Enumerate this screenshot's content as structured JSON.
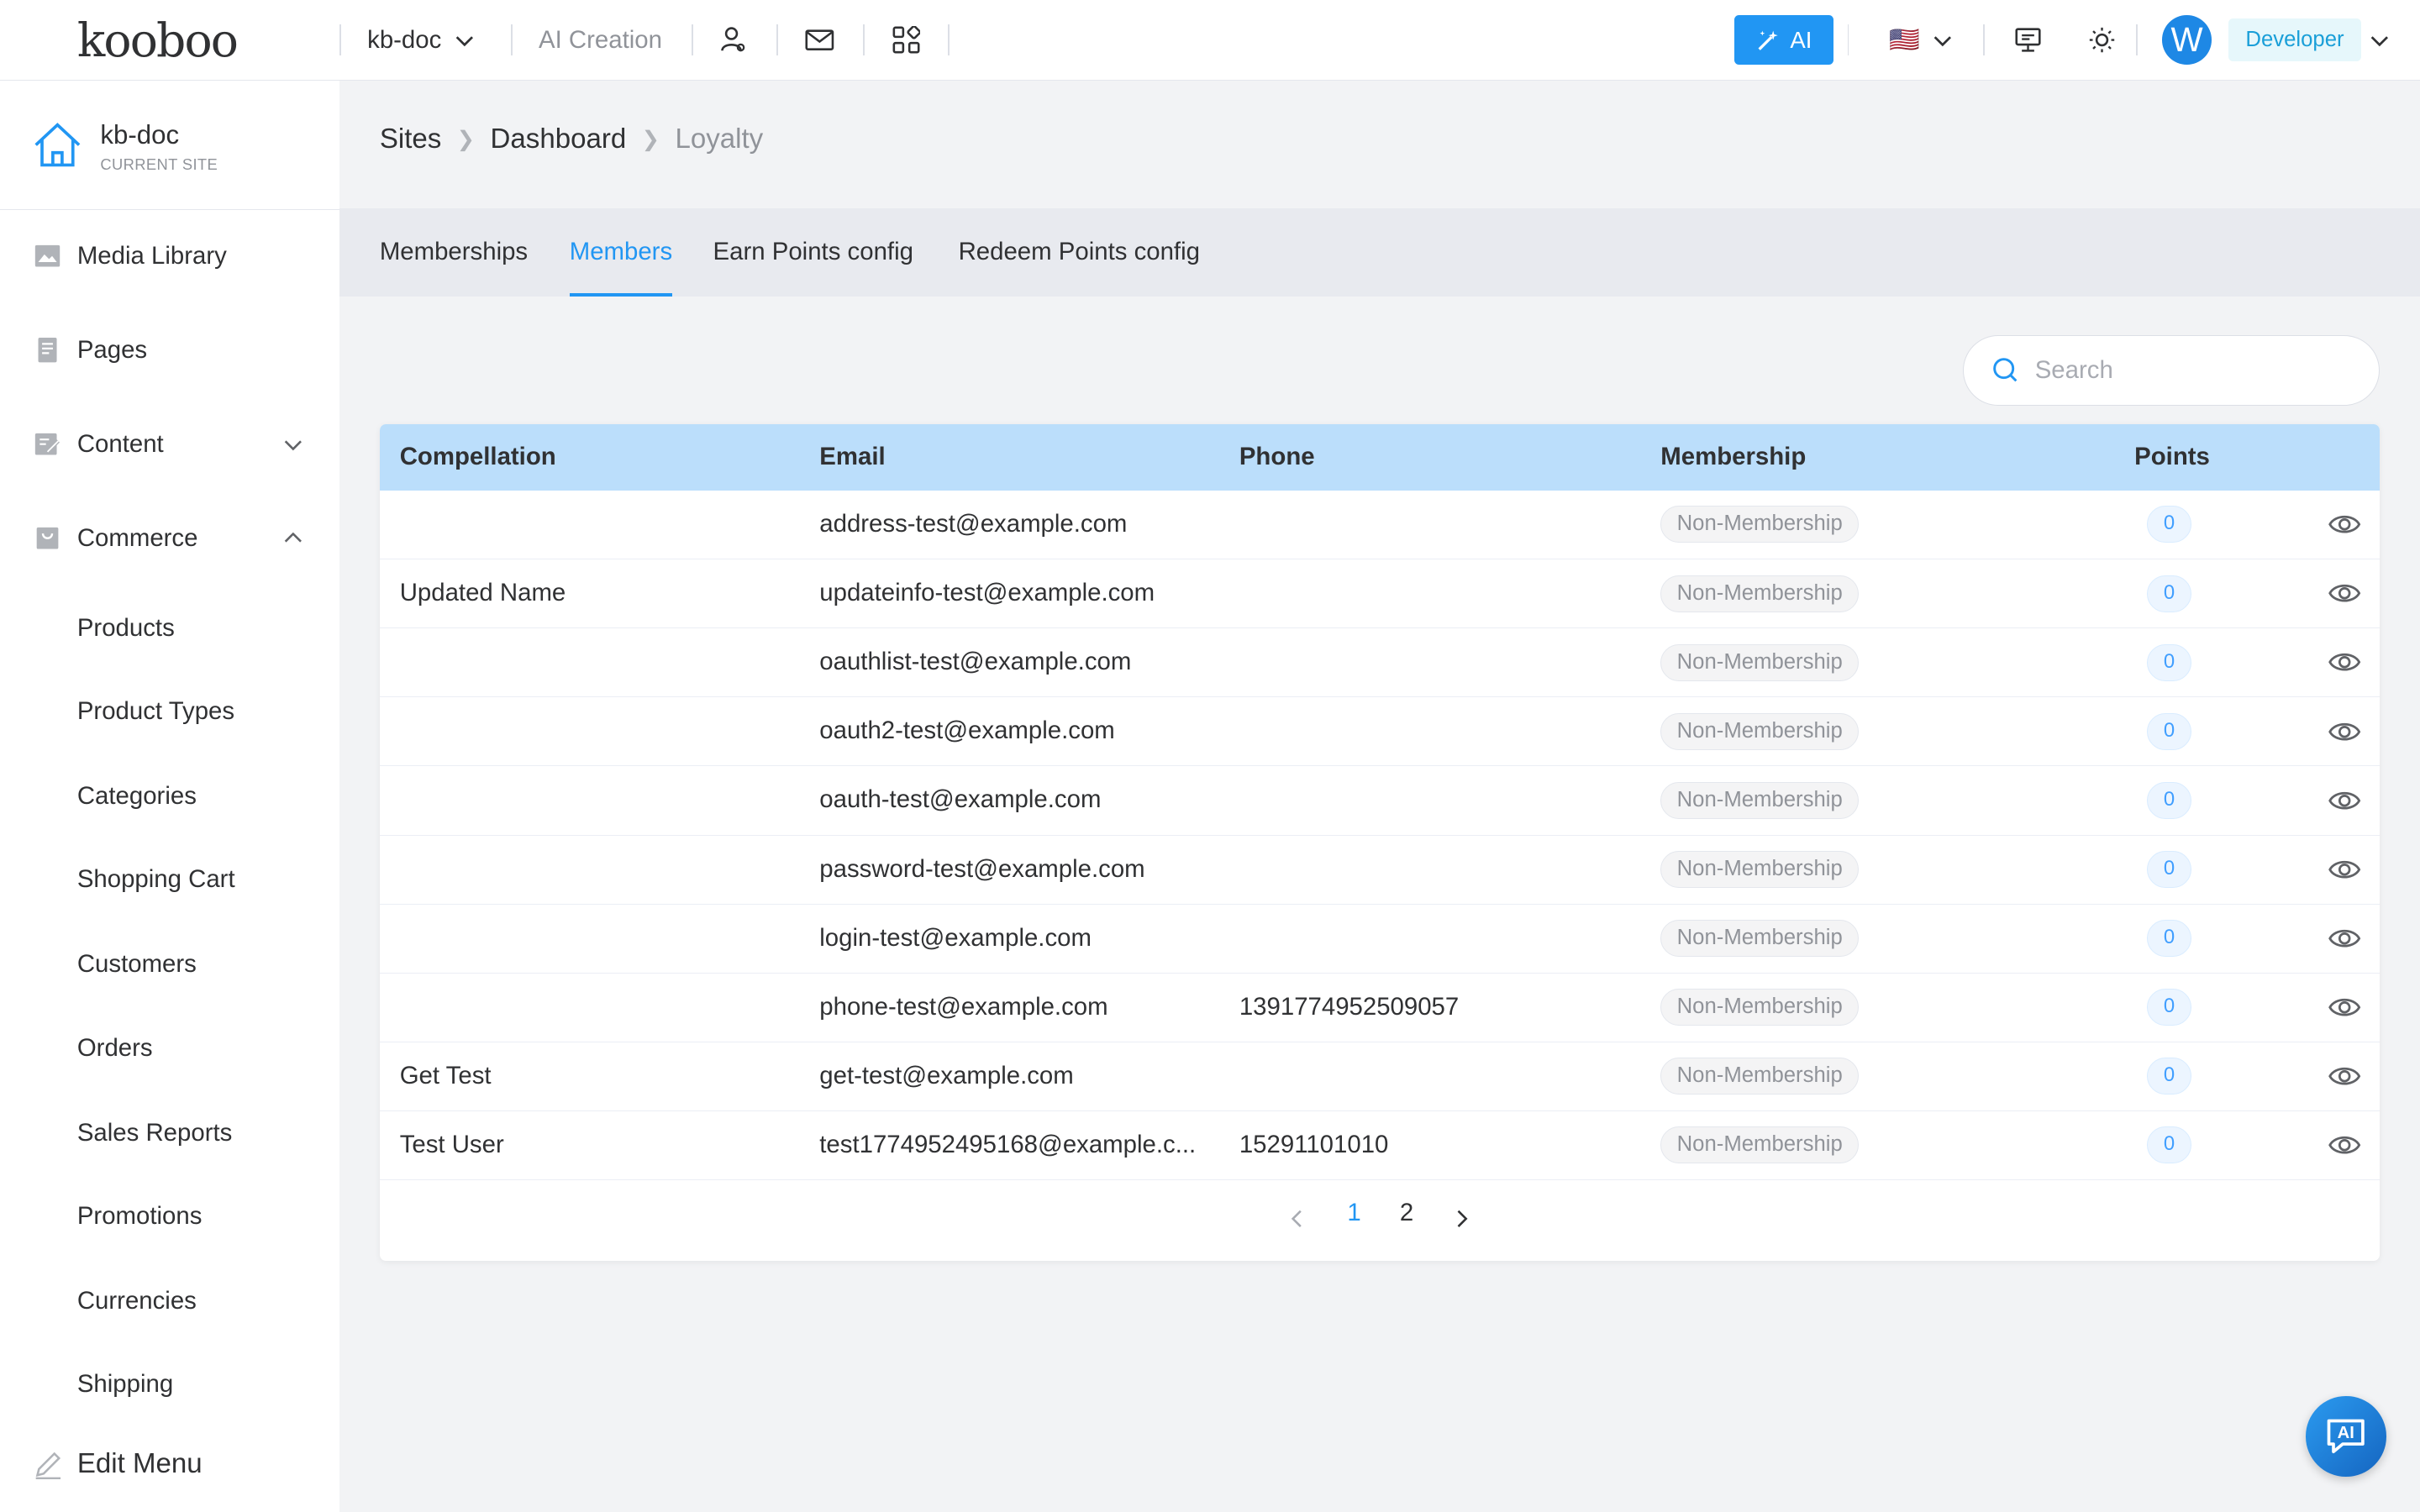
{
  "app": {
    "logo": "kooboo"
  },
  "topbar": {
    "site_selector": "kb-doc",
    "ai_creation": "AI Creation",
    "ai_button": "AI",
    "flag": "🇺🇸",
    "avatar_letter": "W",
    "role": "Developer"
  },
  "site": {
    "name": "kb-doc",
    "sub": "CURRENT SITE"
  },
  "sidebar": {
    "media_library": "Media Library",
    "pages": "Pages",
    "content": "Content",
    "commerce": "Commerce",
    "commerce_items": [
      "Products",
      "Product Types",
      "Categories",
      "Shopping Cart",
      "Customers",
      "Orders",
      "Sales Reports",
      "Promotions",
      "Currencies",
      "Shipping"
    ],
    "edit_menu": "Edit Menu"
  },
  "breadcrumb": [
    "Sites",
    "Dashboard",
    "Loyalty"
  ],
  "tabs": [
    "Memberships",
    "Members",
    "Earn Points config",
    "Redeem Points config"
  ],
  "search": {
    "placeholder": "Search"
  },
  "table": {
    "headers": [
      "Compellation",
      "Email",
      "Phone",
      "Membership",
      "Points"
    ],
    "rows": [
      {
        "name": "",
        "email": "address-test@example.com",
        "phone": "",
        "membership": "Non-Membership",
        "points": "0"
      },
      {
        "name": "Updated Name",
        "email": "updateinfo-test@example.com",
        "phone": "",
        "membership": "Non-Membership",
        "points": "0"
      },
      {
        "name": "",
        "email": "oauthlist-test@example.com",
        "phone": "",
        "membership": "Non-Membership",
        "points": "0"
      },
      {
        "name": "",
        "email": "oauth2-test@example.com",
        "phone": "",
        "membership": "Non-Membership",
        "points": "0"
      },
      {
        "name": "",
        "email": "oauth-test@example.com",
        "phone": "",
        "membership": "Non-Membership",
        "points": "0"
      },
      {
        "name": "",
        "email": "password-test@example.com",
        "phone": "",
        "membership": "Non-Membership",
        "points": "0"
      },
      {
        "name": "",
        "email": "login-test@example.com",
        "phone": "",
        "membership": "Non-Membership",
        "points": "0"
      },
      {
        "name": "",
        "email": "phone-test@example.com",
        "phone": "1391774952509057",
        "membership": "Non-Membership",
        "points": "0"
      },
      {
        "name": "Get Test",
        "email": "get-test@example.com",
        "phone": "",
        "membership": "Non-Membership",
        "points": "0"
      },
      {
        "name": "Test User",
        "email": "test1774952495168@example.c...",
        "phone": "15291101010",
        "membership": "Non-Membership",
        "points": "0"
      }
    ]
  },
  "pagination": {
    "pages": [
      "1",
      "2"
    ],
    "current": "1"
  },
  "ai_float": "AI"
}
